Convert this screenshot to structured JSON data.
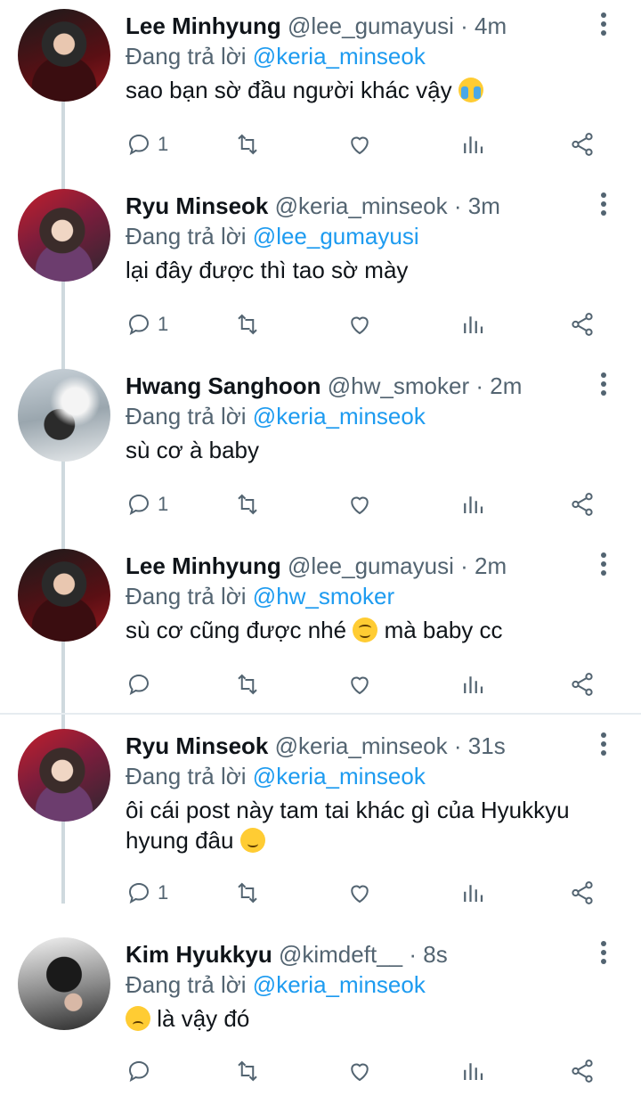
{
  "tweets": [
    {
      "name": "Lee Minhyung",
      "handle": "@lee_gumayusi",
      "dot": "·",
      "time": "4m",
      "replying_prefix": "Đang trả lời",
      "replying_to": "@keria_minseok",
      "text": "sao bạn sờ đầu người khác vậy",
      "emoji": "loudly-crying-face",
      "reply_count": "1",
      "avatar": "gumayusi-photo"
    },
    {
      "name": "Ryu Minseok",
      "handle": "@keria_minseok",
      "dot": "·",
      "time": "3m",
      "replying_prefix": "Đang trả lời",
      "replying_to": "@lee_gumayusi",
      "text": "lại đây được thì tao sờ mày",
      "reply_count": "1",
      "avatar": "keria-photo"
    },
    {
      "name": "Hwang Sanghoon",
      "handle": "@hw_smoker",
      "dot": "·",
      "time": "2m",
      "replying_prefix": "Đang trả lời",
      "replying_to": "@keria_minseok",
      "text": "sù cơ à baby",
      "reply_count": "1",
      "avatar": "smoker-photo"
    },
    {
      "name": "Lee Minhyung",
      "handle": "@lee_gumayusi",
      "dot": "·",
      "time": "2m",
      "replying_prefix": "Đang trả lời",
      "replying_to": "@hw_smoker",
      "text_before": "sù cơ cũng được nhé",
      "emoji": "smiling-face-with-smiling-eyes",
      "text_after": "mà baby cc",
      "reply_count": "",
      "avatar": "gumayusi-photo"
    },
    {
      "name": "Ryu Minseok",
      "handle": "@keria_minseok",
      "dot": "·",
      "time": "31s",
      "replying_prefix": "Đang trả lời",
      "replying_to": "@keria_minseok",
      "text": "ôi cái post này tam tai khác gì của Hyukkyu hyung đâu",
      "emoji": "slightly-smiling-face",
      "reply_count": "1",
      "avatar": "keria-photo"
    },
    {
      "name": "Kim Hyukkyu",
      "handle": "@kimdeft__",
      "dot": "·",
      "time": "8s",
      "replying_prefix": "Đang trả lời",
      "replying_to": "@keria_minseok",
      "emoji": "disappointed-face",
      "text": "là vậy đó",
      "reply_count": "",
      "avatar": "deft-photo"
    }
  ],
  "icons": {
    "reply": "speech-bubble-icon",
    "retweet": "retweet-icon",
    "like": "heart-icon",
    "stats": "bar-chart-icon",
    "share": "share-icon",
    "more": "vertical-ellipsis-icon"
  },
  "colors": {
    "mention": "#1d9bf0",
    "secondary_text": "#536471",
    "thread_line": "#cfd9de"
  }
}
